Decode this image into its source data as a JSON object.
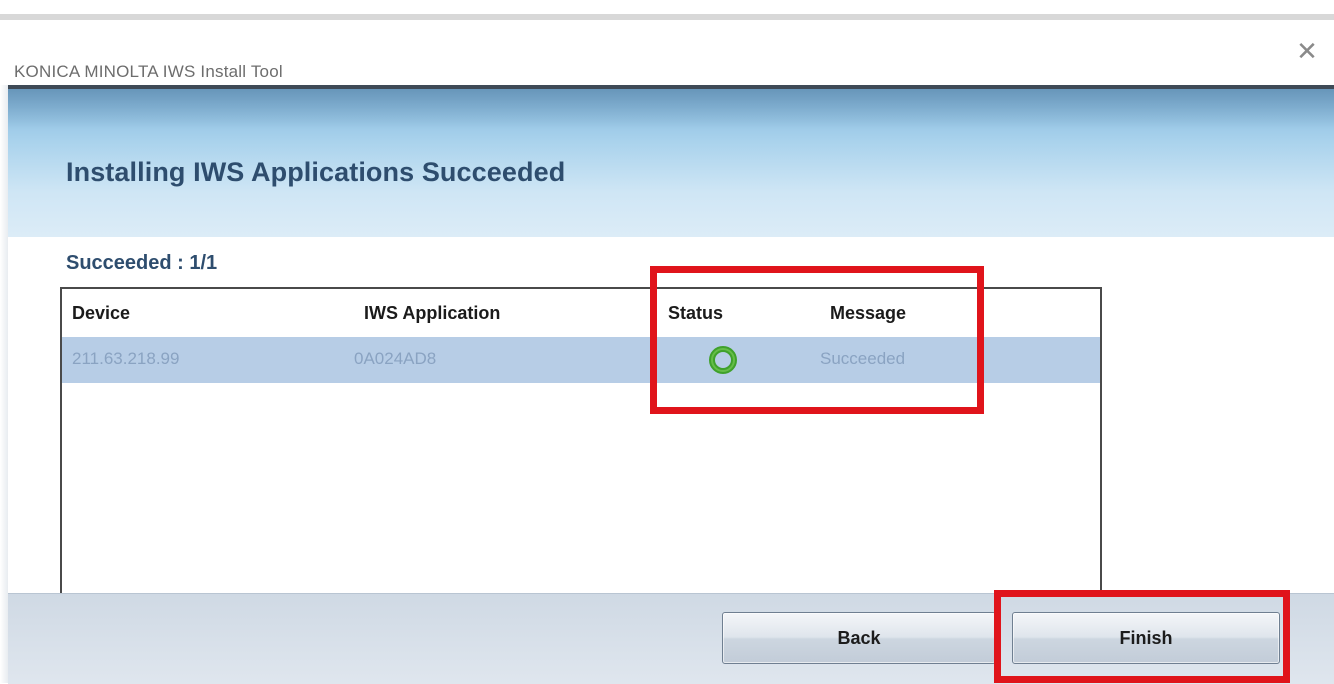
{
  "window": {
    "title": "KONICA MINOLTA IWS Install Tool",
    "close_glyph": "✕"
  },
  "page": {
    "title": "Installing IWS Applications Succeeded",
    "summary": "Succeeded : 1/1"
  },
  "table": {
    "columns": [
      "Device",
      "IWS Application",
      "Status",
      "Message"
    ],
    "rows": [
      {
        "device": "211.63.218.99",
        "application": "0A024AD8",
        "status_icon": "success-ring-icon",
        "message": "Succeeded"
      }
    ]
  },
  "buttons": {
    "back_label": "Back",
    "finish_label": "Finish"
  },
  "colors": {
    "status_ok": "#3fa12b",
    "highlight": "#e0141b",
    "title_text": "#2e4d6e",
    "selected_row": "#b7cde6"
  }
}
